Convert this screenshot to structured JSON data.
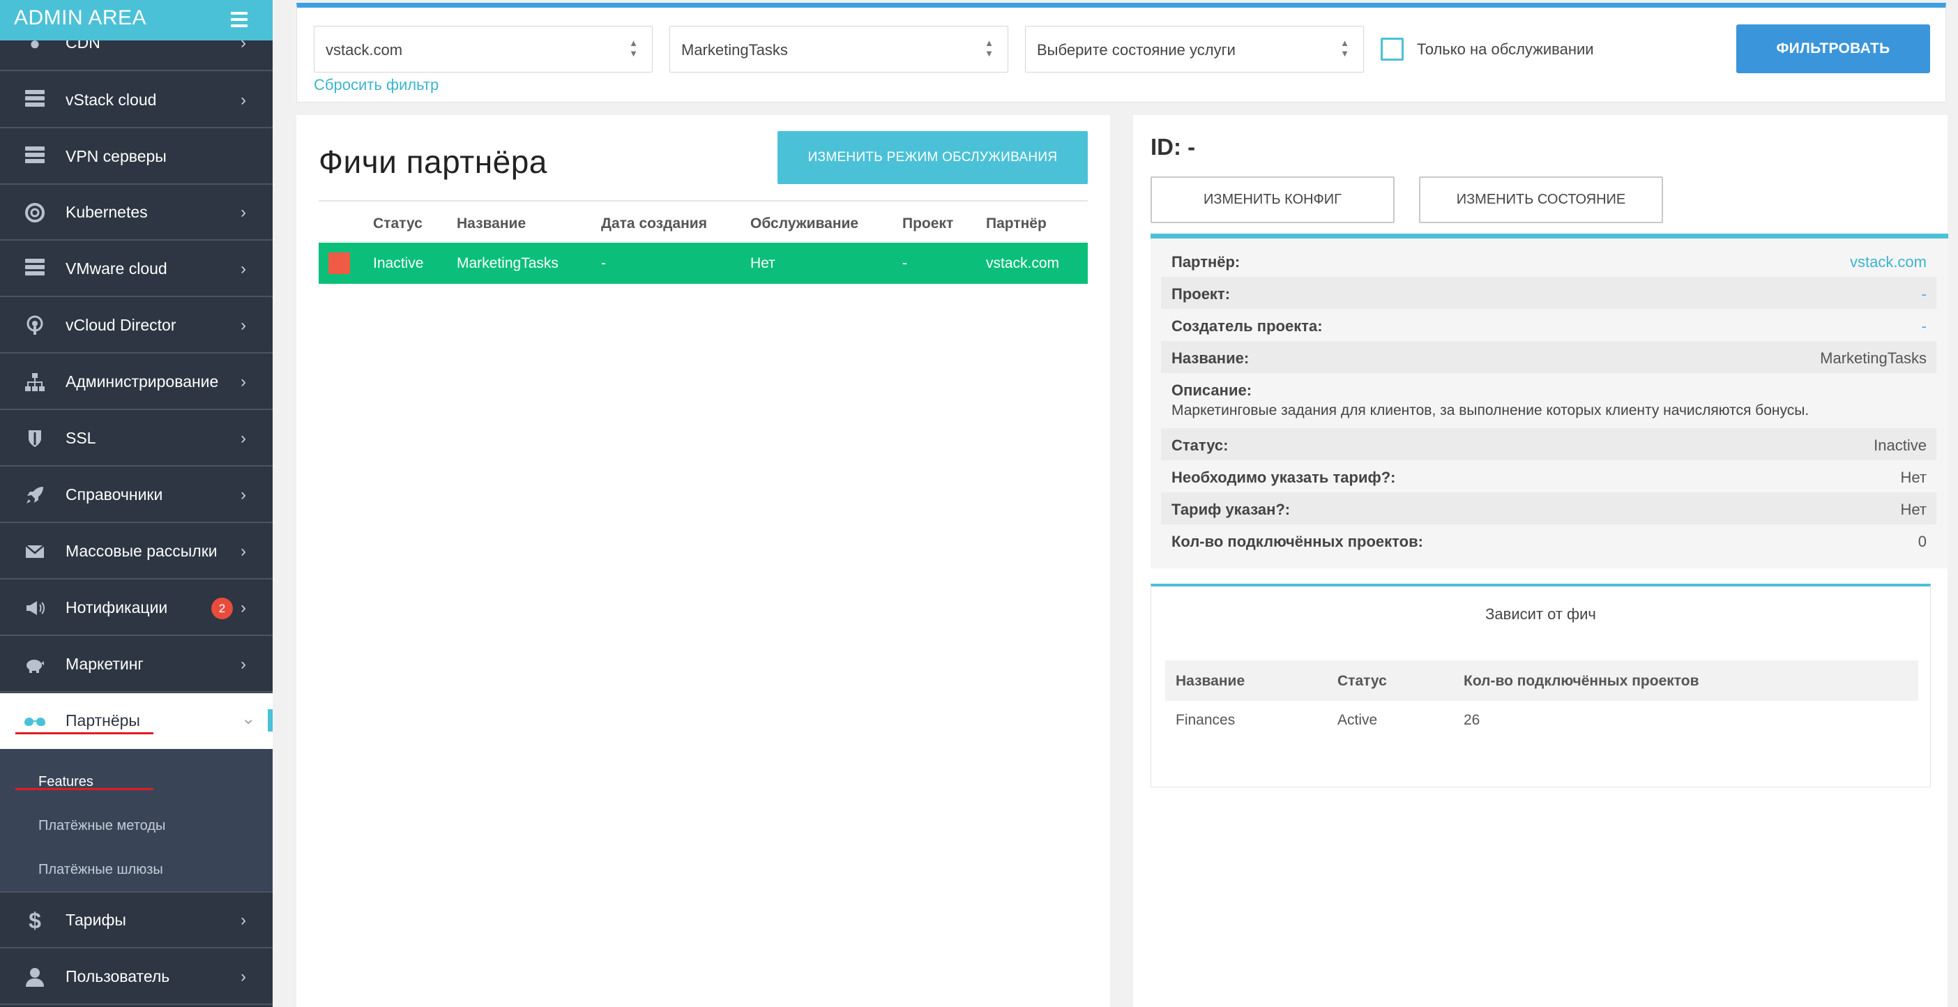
{
  "brand": "ADMIN AREA",
  "sidebar": {
    "items": [
      {
        "label": "CDN",
        "icon": "globe-icon"
      },
      {
        "label": "vStack cloud",
        "icon": "server-icon"
      },
      {
        "label": "VPN серверы",
        "icon": "server-icon"
      },
      {
        "label": "Kubernetes",
        "icon": "lifebuoy-icon"
      },
      {
        "label": "VMware cloud",
        "icon": "server-icon"
      },
      {
        "label": "vCloud Director",
        "icon": "podcast-icon"
      },
      {
        "label": "Администрирование",
        "icon": "sitemap-icon"
      },
      {
        "label": "SSL",
        "icon": "shield-icon"
      },
      {
        "label": "Справочники",
        "icon": "rocket-icon"
      },
      {
        "label": "Массовые рассылки",
        "icon": "envelope-icon"
      },
      {
        "label": "Нотификации",
        "icon": "bullhorn-icon",
        "badge": "2"
      },
      {
        "label": "Маркетинг",
        "icon": "piggy-bank-icon"
      },
      {
        "label": "Партнёры",
        "icon": "glasses-icon"
      },
      {
        "label": "Тарифы",
        "icon": "dollar-icon"
      },
      {
        "label": "Пользователь",
        "icon": "user-icon"
      }
    ],
    "submenu": [
      "Features",
      "Платёжные методы",
      "Платёжные шлюзы"
    ]
  },
  "filter": {
    "partner_select": "vstack.com",
    "feature_select": "MarketingTasks",
    "state_select": "Выберите состояние услуги",
    "maintenance_only": "Только на обслуживании",
    "filter_button": "ФИЛЬТРОВАТЬ",
    "reset_link": "Сбросить фильтр"
  },
  "features": {
    "title": "Фичи партнёра",
    "maintenance_button": "ИЗМЕНИТЬ РЕЖИМ ОБСЛУЖИВАНИЯ",
    "columns": [
      "Статус",
      "Название",
      "Дата создания",
      "Обслуживание",
      "Проект",
      "Партнёр"
    ],
    "rows": [
      {
        "status": "Inactive",
        "name": "MarketingTasks",
        "created": "-",
        "maintenance": "Нет",
        "project": "-",
        "partner": "vstack.com"
      }
    ]
  },
  "details": {
    "id_label": "ID: -",
    "btn_config": "ИЗМЕНИТЬ КОНФИГ",
    "btn_state": "ИЗМЕНИТЬ СОСТОЯНИЕ",
    "partner_k": "Партнёр:",
    "partner_v": "vstack.com",
    "project_k": "Проект:",
    "project_v": "-",
    "creator_k": "Создатель проекта:",
    "creator_v": "-",
    "name_k": "Название:",
    "name_v": "MarketingTasks",
    "desc_k": "Описание:",
    "desc_v": "Маркетинговые задания для клиентов, за выполнение которых клиенту начисляются бонусы.",
    "status_k": "Статус:",
    "status_v": "Inactive",
    "tariff_req_k": "Необходимо указать тариф?:",
    "tariff_req_v": "Нет",
    "tariff_set_k": "Тариф указан?:",
    "tariff_set_v": "Нет",
    "projects_k": "Кол-во подключённых проектов:",
    "projects_v": "0"
  },
  "dependencies": {
    "title": "Зависит от фич",
    "columns": [
      "Название",
      "Статус",
      "Кол-во подключённых проектов"
    ],
    "rows": [
      {
        "name": "Finances",
        "status": "Active",
        "projects": "26"
      }
    ]
  },
  "colors": {
    "accent": "#4bc1d7",
    "primary_button": "#3a95db",
    "sidebar_bg": "#2d3642",
    "row_active": "#0bbf7a",
    "status_square": "#f15a45",
    "badge": "#e74c3c",
    "annotation_underline": "#e31b23"
  }
}
